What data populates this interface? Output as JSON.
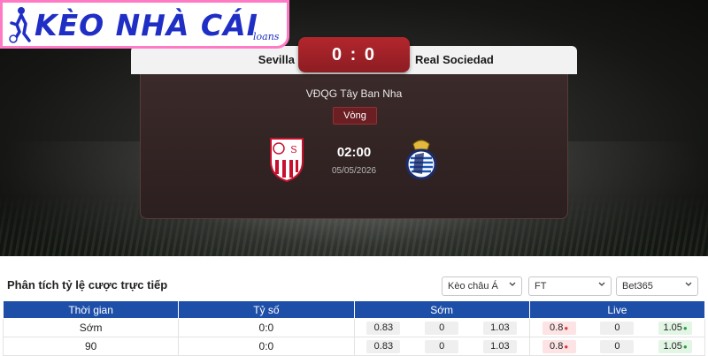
{
  "brand": {
    "name": "KÈO NHÀ CÁI",
    "sub": "loans",
    "pink": "#ff7ac4",
    "blue": "#1f2ec4"
  },
  "match": {
    "home_team": "Sevilla",
    "away_team": "Real Sociedad",
    "score": "0 : 0",
    "league": "VĐQG Tây Ban Nha",
    "round": "Vòng",
    "time": "02:00",
    "date": "05/05/2026",
    "home_crest_icon": "sevilla-crest-icon",
    "away_crest_icon": "real-sociedad-crest-icon"
  },
  "odds": {
    "title": "Phân tích tỷ lệ cược trực tiếp",
    "filters": {
      "market": "Kèo châu Á",
      "period": "FT",
      "bookmaker": "Bet365"
    },
    "headers": [
      "Thời gian",
      "Tỷ số",
      "Sớm",
      "Live"
    ],
    "rows": [
      {
        "time": "Sớm",
        "score": "0:0",
        "early": [
          "0.83",
          "0",
          "1.03"
        ],
        "live": [
          "0.8",
          "0",
          "1.05"
        ]
      },
      {
        "time": "90",
        "score": "0:0",
        "early": [
          "0.83",
          "0",
          "1.03"
        ],
        "live": [
          "0.8",
          "0",
          "1.05"
        ]
      }
    ],
    "colors": {
      "header_bg": "#1e4fa8",
      "down": "#d63a3a",
      "up": "#2b9b43"
    }
  }
}
